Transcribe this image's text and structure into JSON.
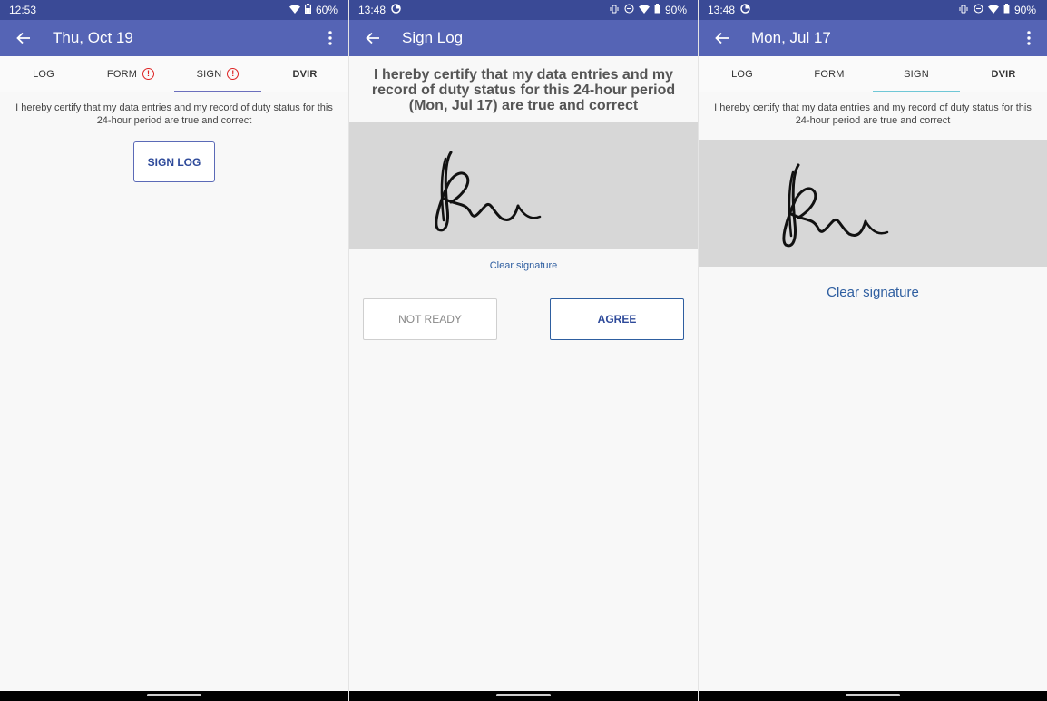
{
  "screens": [
    {
      "status": {
        "time": "12:53",
        "battery": "60%"
      },
      "appbar": {
        "title": "Thu, Oct 19"
      },
      "tabs": [
        {
          "label": "LOG"
        },
        {
          "label": "FORM"
        },
        {
          "label": "SIGN"
        },
        {
          "label": "DVIR"
        }
      ],
      "certify_text": "I hereby certify that my data entries and my record of duty status for this 24-hour period are true and correct",
      "sign_log_label": "SIGN LOG"
    },
    {
      "status": {
        "time": "13:48",
        "battery": "90%"
      },
      "appbar": {
        "title": "Sign Log"
      },
      "certify_text": "I hereby certify that my data entries and my record of duty status for this 24-hour period (Mon, Jul 17) are true and correct",
      "clear_label": "Clear signature",
      "not_ready_label": "NOT READY",
      "agree_label": "AGREE"
    },
    {
      "status": {
        "time": "13:48",
        "battery": "90%"
      },
      "appbar": {
        "title": "Mon, Jul 17"
      },
      "tabs": [
        {
          "label": "LOG"
        },
        {
          "label": "FORM"
        },
        {
          "label": "SIGN"
        },
        {
          "label": "DVIR"
        }
      ],
      "certify_text": "I hereby certify that my data entries and my record of duty status for this 24-hour period are true and correct",
      "clear_label": "Clear signature"
    }
  ],
  "colors": {
    "status_bar": "#3a4a96",
    "app_bar": "#5564b5",
    "warning": "#dd2222",
    "link": "#2e5ea0"
  }
}
